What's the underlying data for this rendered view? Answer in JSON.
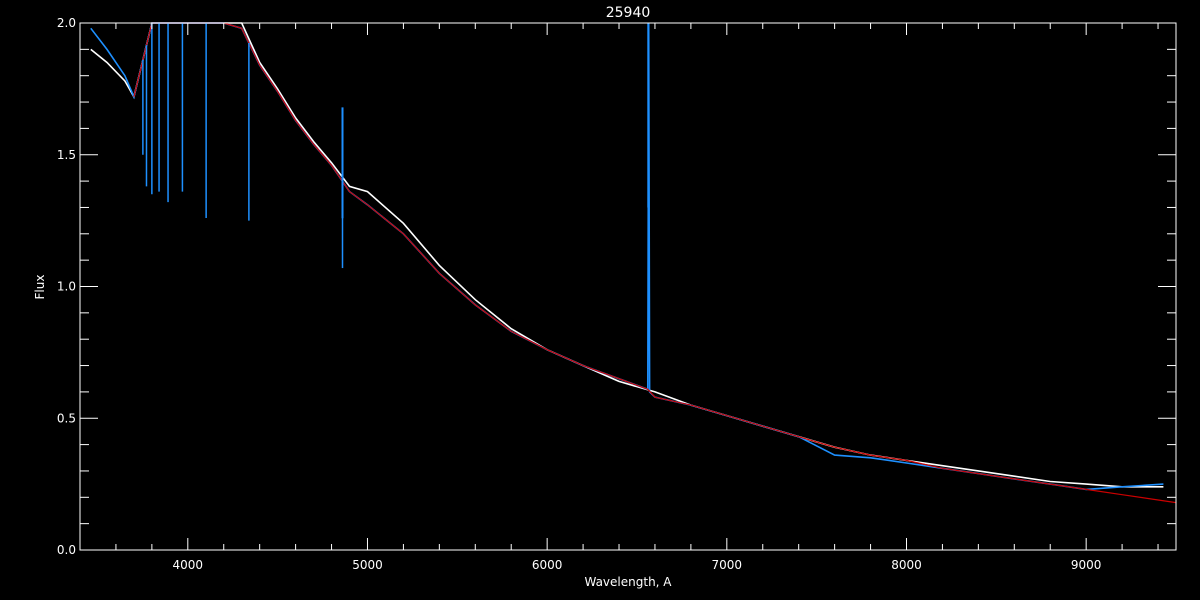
{
  "chart_data": {
    "type": "line",
    "title": "25940",
    "xlabel": "Wavelength, A",
    "ylabel": "Flux",
    "xlim": [
      3400,
      9500
    ],
    "ylim": [
      0.0,
      2.0
    ],
    "x_ticks": [
      4000,
      5000,
      6000,
      7000,
      8000,
      9000
    ],
    "y_ticks": [
      0.0,
      0.5,
      1.0,
      1.5,
      2.0
    ],
    "x_tick_labels": [
      "4000",
      "5000",
      "6000",
      "7000",
      "8000",
      "9000"
    ],
    "y_tick_labels": [
      "0.0",
      "0.5",
      "1.0",
      "1.5",
      "2.0"
    ],
    "grid": false,
    "legend": "none",
    "background_color": "#000000",
    "axis_color": "#ffffff",
    "series": [
      {
        "color": "#ffffff",
        "x": [
          3460,
          3550,
          3650,
          3700,
          3800,
          3900,
          4000,
          4100,
          4200,
          4300,
          4400,
          4500,
          4600,
          4700,
          4800,
          4900,
          5000,
          5200,
          5400,
          5600,
          5800,
          6000,
          6200,
          6400,
          6600,
          6800,
          7000,
          7200,
          7400,
          7600,
          7800,
          8000,
          8200,
          8400,
          8600,
          8800,
          9000,
          9200,
          9430
        ],
        "y": [
          1.9,
          1.85,
          1.78,
          1.72,
          2.0,
          2.0,
          2.0,
          2.0,
          2.0,
          2.0,
          1.85,
          1.75,
          1.64,
          1.55,
          1.47,
          1.38,
          1.36,
          1.24,
          1.08,
          0.95,
          0.84,
          0.76,
          0.7,
          0.64,
          0.6,
          0.55,
          0.51,
          0.47,
          0.43,
          0.39,
          0.36,
          0.34,
          0.32,
          0.3,
          0.28,
          0.26,
          0.25,
          0.24,
          0.24
        ]
      },
      {
        "color": "#1e90ff",
        "x": [
          3460,
          3550,
          3650,
          3700,
          3800,
          3900,
          4000,
          4100,
          4200,
          4300,
          4400,
          4500,
          4600,
          4700,
          4800,
          4900,
          5000,
          5200,
          5400,
          5600,
          5800,
          6000,
          6200,
          6400,
          6560,
          6565,
          6570,
          6600,
          6800,
          7000,
          7200,
          7400,
          7600,
          7800,
          8000,
          8200,
          8400,
          8600,
          8800,
          9000,
          9200,
          9430
        ],
        "y": [
          1.98,
          1.9,
          1.8,
          1.72,
          2.0,
          2.0,
          2.0,
          2.0,
          2.0,
          1.98,
          1.84,
          1.74,
          1.63,
          1.54,
          1.46,
          1.36,
          1.31,
          1.2,
          1.05,
          0.93,
          0.83,
          0.76,
          0.7,
          0.65,
          0.61,
          2.0,
          0.6,
          0.58,
          0.55,
          0.51,
          0.47,
          0.43,
          0.36,
          0.35,
          0.33,
          0.31,
          0.29,
          0.27,
          0.25,
          0.23,
          0.24,
          0.25
        ]
      },
      {
        "color": "#cc0000",
        "x": [
          3700,
          3800,
          3900,
          4000,
          4100,
          4200,
          4300,
          4400,
          4500,
          4600,
          4700,
          4800,
          4900,
          5000,
          5200,
          5400,
          5600,
          5800,
          6000,
          6200,
          6400,
          6560,
          6600,
          6800,
          7000,
          7200,
          7400,
          7600,
          7800,
          8000,
          8200,
          8400,
          8600,
          8800,
          9000,
          9200,
          9500
        ],
        "y": [
          1.72,
          2.0,
          2.0,
          2.0,
          2.0,
          2.0,
          1.98,
          1.84,
          1.74,
          1.63,
          1.54,
          1.46,
          1.36,
          1.31,
          1.2,
          1.05,
          0.93,
          0.83,
          0.76,
          0.7,
          0.65,
          0.61,
          0.58,
          0.55,
          0.51,
          0.47,
          0.43,
          0.39,
          0.36,
          0.34,
          0.31,
          0.29,
          0.27,
          0.25,
          0.23,
          0.21,
          0.18
        ]
      }
    ],
    "absorption_lines": [
      {
        "x": 3750,
        "y": 1.5
      },
      {
        "x": 3770,
        "y": 1.38
      },
      {
        "x": 3800,
        "y": 1.35
      },
      {
        "x": 3840,
        "y": 1.36
      },
      {
        "x": 3890,
        "y": 1.32
      },
      {
        "x": 3970,
        "y": 1.36
      },
      {
        "x": 4102,
        "y": 1.26
      },
      {
        "x": 4340,
        "y": 1.25
      },
      {
        "x": 4861,
        "y": 1.07
      }
    ],
    "emission_spikes": [
      {
        "x": 4861,
        "y": 1.68
      },
      {
        "x": 6563,
        "y": 2.0
      }
    ]
  }
}
